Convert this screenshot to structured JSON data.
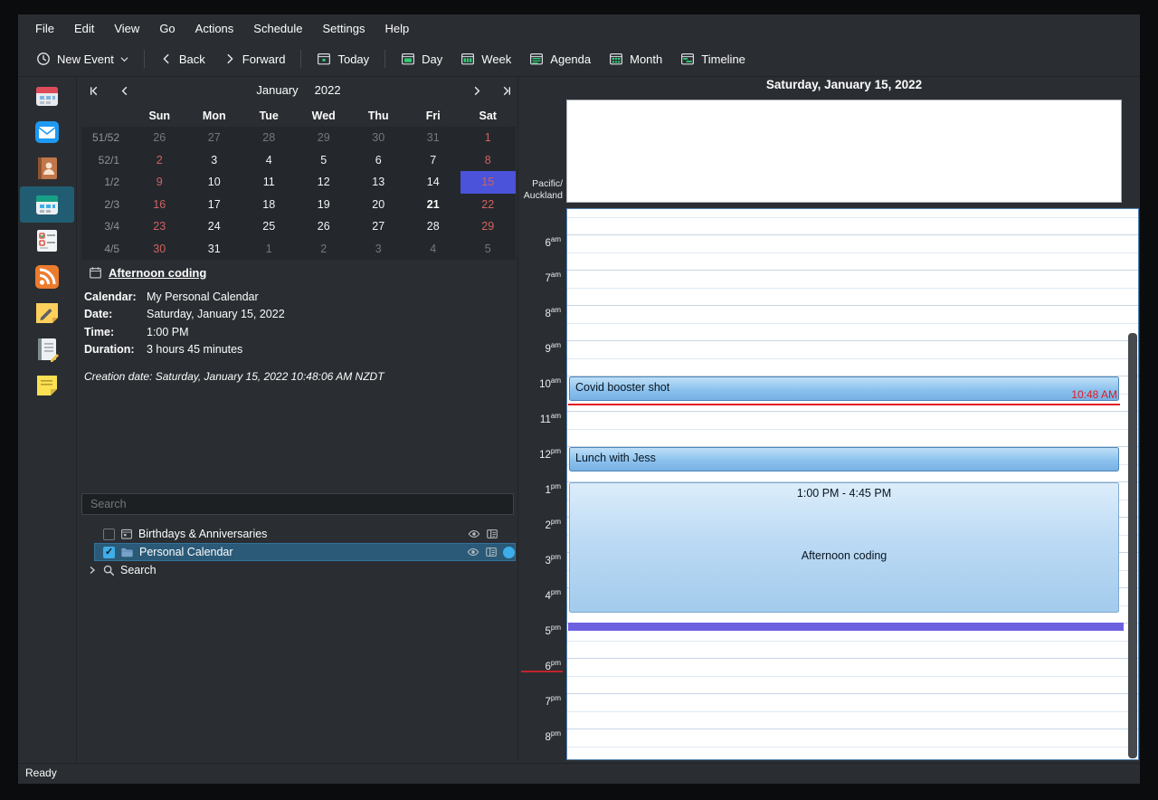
{
  "menu": [
    "File",
    "Edit",
    "View",
    "Go",
    "Actions",
    "Schedule",
    "Settings",
    "Help"
  ],
  "toolbar": {
    "new_event": {
      "label": "New Event",
      "icon": "clock-icon"
    },
    "back": {
      "label": "Back",
      "icon": "chevron-left-icon"
    },
    "forward": {
      "label": "Forward",
      "icon": "chevron-right-icon"
    },
    "today": {
      "label": "Today",
      "icon": "calendar-today-icon"
    },
    "day": {
      "label": "Day",
      "icon": "calendar-day-icon"
    },
    "week": {
      "label": "Week",
      "icon": "calendar-week-icon"
    },
    "agenda": {
      "label": "Agenda",
      "icon": "calendar-agenda-icon"
    },
    "month": {
      "label": "Month",
      "icon": "calendar-month-icon"
    },
    "timeline": {
      "label": "Timeline",
      "icon": "calendar-timeline-icon"
    }
  },
  "sidebar_icons": [
    "calendar-summary-icon",
    "mail-icon",
    "contacts-icon",
    "calendar-icon",
    "todo-list-icon",
    "rss-feeds-icon",
    "notes-icon",
    "journal-icon",
    "sticky-note-icon"
  ],
  "sidebar_selected_index": 3,
  "date_navigator": {
    "month": "January",
    "year": "2022",
    "day_headers": [
      "Sun",
      "Mon",
      "Tue",
      "Wed",
      "Thu",
      "Fri",
      "Sat"
    ],
    "weeks": [
      {
        "label": "51/52",
        "days": [
          {
            "t": "26",
            "s": "dim"
          },
          {
            "t": "27",
            "s": "dim"
          },
          {
            "t": "28",
            "s": "dim"
          },
          {
            "t": "29",
            "s": "dim"
          },
          {
            "t": "30",
            "s": "dim"
          },
          {
            "t": "31",
            "s": "dim"
          },
          {
            "t": "1",
            "s": "red"
          }
        ]
      },
      {
        "label": "52/1",
        "days": [
          {
            "t": "2",
            "s": "red"
          },
          {
            "t": "3",
            "s": "n"
          },
          {
            "t": "4",
            "s": "n"
          },
          {
            "t": "5",
            "s": "n"
          },
          {
            "t": "6",
            "s": "n"
          },
          {
            "t": "7",
            "s": "n"
          },
          {
            "t": "8",
            "s": "red"
          }
        ]
      },
      {
        "label": "1/2",
        "days": [
          {
            "t": "9",
            "s": "red"
          },
          {
            "t": "10",
            "s": "n"
          },
          {
            "t": "11",
            "s": "n"
          },
          {
            "t": "12",
            "s": "n"
          },
          {
            "t": "13",
            "s": "n"
          },
          {
            "t": "14",
            "s": "n"
          },
          {
            "t": "15",
            "s": "sel"
          }
        ]
      },
      {
        "label": "2/3",
        "days": [
          {
            "t": "16",
            "s": "red"
          },
          {
            "t": "17",
            "s": "n"
          },
          {
            "t": "18",
            "s": "n"
          },
          {
            "t": "19",
            "s": "n"
          },
          {
            "t": "20",
            "s": "n"
          },
          {
            "t": "21",
            "s": "today"
          },
          {
            "t": "22",
            "s": "red"
          }
        ]
      },
      {
        "label": "3/4",
        "days": [
          {
            "t": "23",
            "s": "red"
          },
          {
            "t": "24",
            "s": "n"
          },
          {
            "t": "25",
            "s": "n"
          },
          {
            "t": "26",
            "s": "n"
          },
          {
            "t": "27",
            "s": "n"
          },
          {
            "t": "28",
            "s": "n"
          },
          {
            "t": "29",
            "s": "red"
          }
        ]
      },
      {
        "label": "4/5",
        "days": [
          {
            "t": "30",
            "s": "red"
          },
          {
            "t": "31",
            "s": "n"
          },
          {
            "t": "1",
            "s": "dim"
          },
          {
            "t": "2",
            "s": "dim"
          },
          {
            "t": "3",
            "s": "dim"
          },
          {
            "t": "4",
            "s": "dim"
          },
          {
            "t": "5",
            "s": "dim"
          }
        ]
      }
    ]
  },
  "event_details": {
    "title": "Afternoon coding",
    "fields": [
      {
        "label": "Calendar:",
        "value": "My Personal Calendar"
      },
      {
        "label": "Date:",
        "value": "Saturday, January 15, 2022"
      },
      {
        "label": "Time:",
        "value": "1:00 PM"
      },
      {
        "label": "Duration:",
        "value": "3 hours 45 minutes"
      }
    ],
    "creation_note": "Creation date: Saturday, January 15, 2022 10:48:06 AM NZDT"
  },
  "search": {
    "placeholder": "Search"
  },
  "calendar_list": {
    "items": [
      {
        "label": "Birthdays & Anniversaries",
        "checked": false,
        "selected": false
      },
      {
        "label": "Personal Calendar",
        "checked": true,
        "selected": true,
        "color": "#3daee9"
      }
    ],
    "search_label": "Search"
  },
  "agenda": {
    "header": "Saturday, January 15, 2022",
    "timezone": [
      "Pacific/",
      "Auckland"
    ],
    "hour_labels": [
      {
        "n": "6",
        "ap": "am"
      },
      {
        "n": "7",
        "ap": "am"
      },
      {
        "n": "8",
        "ap": "am"
      },
      {
        "n": "9",
        "ap": "am"
      },
      {
        "n": "10",
        "ap": "am"
      },
      {
        "n": "11",
        "ap": "am"
      },
      {
        "n": "12",
        "ap": "pm"
      },
      {
        "n": "1",
        "ap": "pm"
      },
      {
        "n": "2",
        "ap": "pm"
      },
      {
        "n": "3",
        "ap": "pm"
      },
      {
        "n": "4",
        "ap": "pm"
      },
      {
        "n": "5",
        "ap": "pm"
      },
      {
        "n": "6",
        "ap": "pm"
      },
      {
        "n": "7",
        "ap": "pm"
      },
      {
        "n": "8",
        "ap": "pm"
      }
    ],
    "events": [
      {
        "title": "Covid booster shot",
        "start": "10:00",
        "end": "10:45",
        "variant": "blue"
      },
      {
        "title": "Lunch with Jess",
        "start": "12:00",
        "end": "12:45",
        "variant": "blue"
      },
      {
        "title": "Afternoon coding",
        "time_range": "1:00 PM - 4:45 PM",
        "start": "13:00",
        "end": "16:45",
        "variant": "light"
      }
    ],
    "now_line": {
      "time": "10:48",
      "label": "10:48 AM"
    },
    "marker": {
      "time": "17:00"
    }
  },
  "statusbar": {
    "text": "Ready"
  },
  "colors": {
    "selection": "#3daee9",
    "date_sel_bg": "#4a53da",
    "weekend_red": "#d06161",
    "now_red": "#e01b24",
    "marker_purple": "#6c5fe0",
    "event_blue": "#8cc2ee",
    "event_light_blue": "#bcdaf4"
  }
}
